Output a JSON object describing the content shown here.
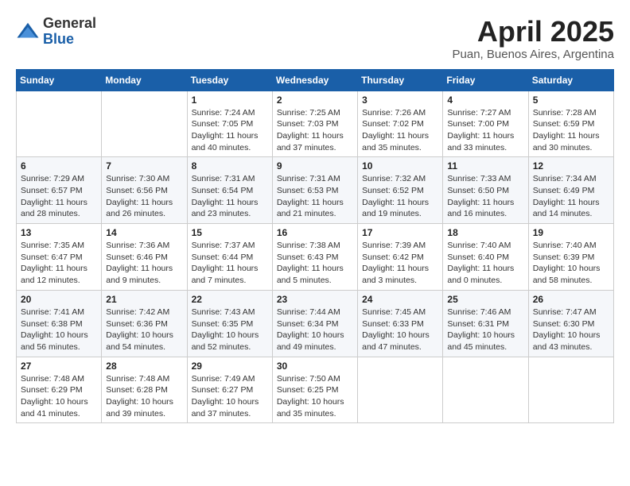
{
  "logo": {
    "general": "General",
    "blue": "Blue"
  },
  "title": {
    "month": "April 2025",
    "location": "Puan, Buenos Aires, Argentina"
  },
  "days_of_week": [
    "Sunday",
    "Monday",
    "Tuesday",
    "Wednesday",
    "Thursday",
    "Friday",
    "Saturday"
  ],
  "weeks": [
    [
      {
        "day": null,
        "info": ""
      },
      {
        "day": null,
        "info": ""
      },
      {
        "day": "1",
        "info": "Sunrise: 7:24 AM\nSunset: 7:05 PM\nDaylight: 11 hours and 40 minutes."
      },
      {
        "day": "2",
        "info": "Sunrise: 7:25 AM\nSunset: 7:03 PM\nDaylight: 11 hours and 37 minutes."
      },
      {
        "day": "3",
        "info": "Sunrise: 7:26 AM\nSunset: 7:02 PM\nDaylight: 11 hours and 35 minutes."
      },
      {
        "day": "4",
        "info": "Sunrise: 7:27 AM\nSunset: 7:00 PM\nDaylight: 11 hours and 33 minutes."
      },
      {
        "day": "5",
        "info": "Sunrise: 7:28 AM\nSunset: 6:59 PM\nDaylight: 11 hours and 30 minutes."
      }
    ],
    [
      {
        "day": "6",
        "info": "Sunrise: 7:29 AM\nSunset: 6:57 PM\nDaylight: 11 hours and 28 minutes."
      },
      {
        "day": "7",
        "info": "Sunrise: 7:30 AM\nSunset: 6:56 PM\nDaylight: 11 hours and 26 minutes."
      },
      {
        "day": "8",
        "info": "Sunrise: 7:31 AM\nSunset: 6:54 PM\nDaylight: 11 hours and 23 minutes."
      },
      {
        "day": "9",
        "info": "Sunrise: 7:31 AM\nSunset: 6:53 PM\nDaylight: 11 hours and 21 minutes."
      },
      {
        "day": "10",
        "info": "Sunrise: 7:32 AM\nSunset: 6:52 PM\nDaylight: 11 hours and 19 minutes."
      },
      {
        "day": "11",
        "info": "Sunrise: 7:33 AM\nSunset: 6:50 PM\nDaylight: 11 hours and 16 minutes."
      },
      {
        "day": "12",
        "info": "Sunrise: 7:34 AM\nSunset: 6:49 PM\nDaylight: 11 hours and 14 minutes."
      }
    ],
    [
      {
        "day": "13",
        "info": "Sunrise: 7:35 AM\nSunset: 6:47 PM\nDaylight: 11 hours and 12 minutes."
      },
      {
        "day": "14",
        "info": "Sunrise: 7:36 AM\nSunset: 6:46 PM\nDaylight: 11 hours and 9 minutes."
      },
      {
        "day": "15",
        "info": "Sunrise: 7:37 AM\nSunset: 6:44 PM\nDaylight: 11 hours and 7 minutes."
      },
      {
        "day": "16",
        "info": "Sunrise: 7:38 AM\nSunset: 6:43 PM\nDaylight: 11 hours and 5 minutes."
      },
      {
        "day": "17",
        "info": "Sunrise: 7:39 AM\nSunset: 6:42 PM\nDaylight: 11 hours and 3 minutes."
      },
      {
        "day": "18",
        "info": "Sunrise: 7:40 AM\nSunset: 6:40 PM\nDaylight: 11 hours and 0 minutes."
      },
      {
        "day": "19",
        "info": "Sunrise: 7:40 AM\nSunset: 6:39 PM\nDaylight: 10 hours and 58 minutes."
      }
    ],
    [
      {
        "day": "20",
        "info": "Sunrise: 7:41 AM\nSunset: 6:38 PM\nDaylight: 10 hours and 56 minutes."
      },
      {
        "day": "21",
        "info": "Sunrise: 7:42 AM\nSunset: 6:36 PM\nDaylight: 10 hours and 54 minutes."
      },
      {
        "day": "22",
        "info": "Sunrise: 7:43 AM\nSunset: 6:35 PM\nDaylight: 10 hours and 52 minutes."
      },
      {
        "day": "23",
        "info": "Sunrise: 7:44 AM\nSunset: 6:34 PM\nDaylight: 10 hours and 49 minutes."
      },
      {
        "day": "24",
        "info": "Sunrise: 7:45 AM\nSunset: 6:33 PM\nDaylight: 10 hours and 47 minutes."
      },
      {
        "day": "25",
        "info": "Sunrise: 7:46 AM\nSunset: 6:31 PM\nDaylight: 10 hours and 45 minutes."
      },
      {
        "day": "26",
        "info": "Sunrise: 7:47 AM\nSunset: 6:30 PM\nDaylight: 10 hours and 43 minutes."
      }
    ],
    [
      {
        "day": "27",
        "info": "Sunrise: 7:48 AM\nSunset: 6:29 PM\nDaylight: 10 hours and 41 minutes."
      },
      {
        "day": "28",
        "info": "Sunrise: 7:48 AM\nSunset: 6:28 PM\nDaylight: 10 hours and 39 minutes."
      },
      {
        "day": "29",
        "info": "Sunrise: 7:49 AM\nSunset: 6:27 PM\nDaylight: 10 hours and 37 minutes."
      },
      {
        "day": "30",
        "info": "Sunrise: 7:50 AM\nSunset: 6:25 PM\nDaylight: 10 hours and 35 minutes."
      },
      {
        "day": null,
        "info": ""
      },
      {
        "day": null,
        "info": ""
      },
      {
        "day": null,
        "info": ""
      }
    ]
  ]
}
